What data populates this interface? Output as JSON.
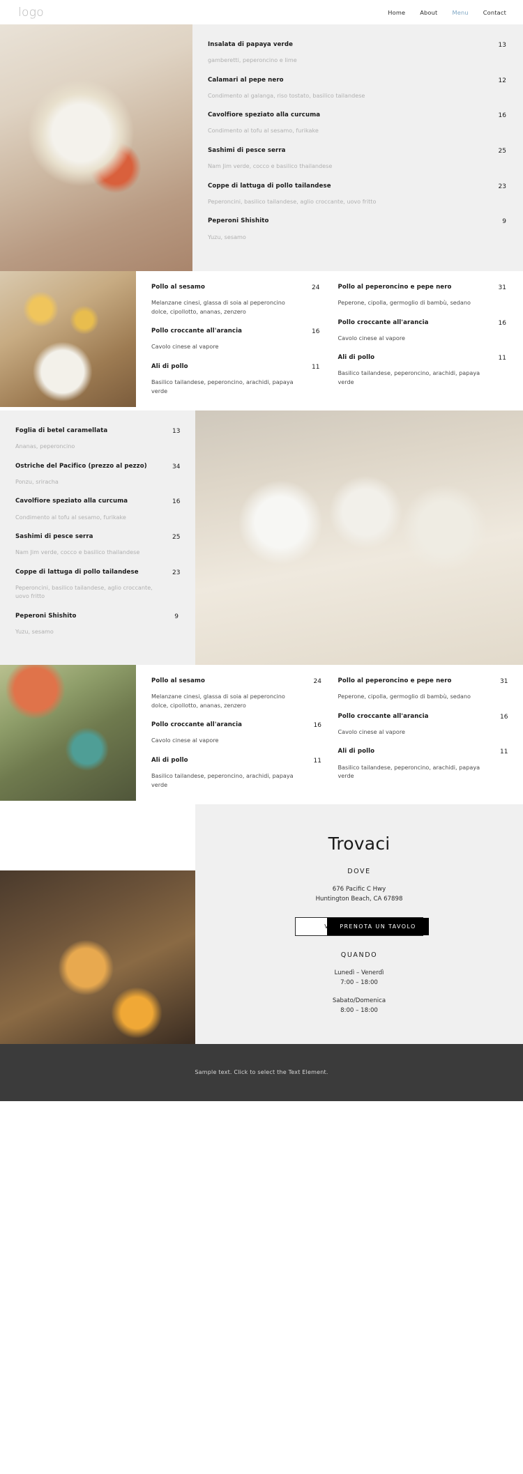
{
  "header": {
    "logo": "logo",
    "nav": [
      {
        "label": "Home",
        "active": false
      },
      {
        "label": "About",
        "active": false
      },
      {
        "label": "Menu",
        "active": true
      },
      {
        "label": "Contact",
        "active": false
      }
    ]
  },
  "sections": {
    "section1": {
      "photo_name": "dining-plate-photo",
      "items": [
        {
          "name": "Insalata di papaya verde",
          "price": "13",
          "desc": "gamberetti, peperoncino e lime"
        },
        {
          "name": "Calamari al pepe nero",
          "price": "12",
          "desc": "Condimento al galanga, riso tostato, basilico tailandese"
        },
        {
          "name": "Cavolfiore speziato alla curcuma",
          "price": "16",
          "desc": "Condimento al tofu al sesamo, furikake"
        },
        {
          "name": "Sashimi di pesce serra",
          "price": "25",
          "desc": "Nam Jim verde, cocco e basilico thailandese"
        },
        {
          "name": "Coppe di lattuga di pollo tailandese",
          "price": "23",
          "desc": "Peperoncini, basilico tailandese, aglio croccante, uovo fritto"
        },
        {
          "name": "Peperoni Shishito",
          "price": "9",
          "desc": "Yuzu, sesamo"
        }
      ]
    },
    "section2": {
      "photo_name": "beer-table-photo",
      "left_items": [
        {
          "name": "Pollo al sesamo",
          "price": "24",
          "desc": "Melanzane cinesi, glassa di soia al peperoncino dolce, cipollotto, ananas, zenzero"
        },
        {
          "name": "Pollo croccante all'arancia",
          "price": "16",
          "desc": "Cavolo cinese al vapore"
        },
        {
          "name": "Ali di pollo",
          "price": "11",
          "desc": "Basilico tailandese, peperoncino, arachidi, papaya verde"
        }
      ],
      "right_items": [
        {
          "name": "Pollo al peperoncino e pepe nero",
          "price": "31",
          "desc": "Peperone, cipolla, germoglio di bambù, sedano"
        },
        {
          "name": "Pollo croccante all'arancia",
          "price": "16",
          "desc": "Cavolo cinese al vapore"
        },
        {
          "name": "Ali di pollo",
          "price": "11",
          "desc": "Basilico tailandese, peperoncino, arachidi, papaya verde"
        }
      ]
    },
    "section3": {
      "photo_name": "wine-glasses-table-photo",
      "items": [
        {
          "name": "Foglia di betel caramellata",
          "price": "13",
          "desc": "Ananas, peperoncino"
        },
        {
          "name": "Ostriche del Pacifico (prezzo al pezzo)",
          "price": "34",
          "desc": "Ponzu, sriracha"
        },
        {
          "name": "Cavolfiore speziato alla curcuma",
          "price": "16",
          "desc": "Condimento al tofu al sesamo, furikake"
        },
        {
          "name": "Sashimi di pesce serra",
          "price": "25",
          "desc": "Nam Jim verde, cocco e basilico thailandese"
        },
        {
          "name": "Coppe di lattuga di pollo tailandese",
          "price": "23",
          "desc": "Peperoncini, basilico tailandese, aglio croccante, uovo fritto"
        },
        {
          "name": "Peperoni Shishito",
          "price": "9",
          "desc": "Yuzu, sesamo"
        }
      ]
    },
    "section4": {
      "photo_name": "patio-seating-photo",
      "left_items": [
        {
          "name": "Pollo al sesamo",
          "price": "24",
          "desc": "Melanzane cinesi, glassa di soia al peperoncino dolce, cipollotto, ananas, zenzero"
        },
        {
          "name": "Pollo croccante all'arancia",
          "price": "16",
          "desc": "Cavolo cinese al vapore"
        },
        {
          "name": "Ali di pollo",
          "price": "11",
          "desc": "Basilico tailandese, peperoncino, arachidi, papaya verde"
        }
      ],
      "right_items": [
        {
          "name": "Pollo al peperoncino e pepe nero",
          "price": "31",
          "desc": "Peperone, cipolla, germoglio di bambù, sedano"
        },
        {
          "name": "Pollo croccante all'arancia",
          "price": "16",
          "desc": "Cavolo cinese al vapore"
        },
        {
          "name": "Ali di pollo",
          "price": "11",
          "desc": "Basilico tailandese, peperoncino, arachidi, papaya verde"
        }
      ]
    }
  },
  "contact": {
    "photo_name": "server-with-food-photo",
    "title": "Trovaci",
    "where_label": "DOVE",
    "address_line1": "676 Pacific C Hwy",
    "address_line2": "Huntington Beach, CA 67898",
    "button_outline": "VISUALIZZA MAPPA",
    "button_filled": "PRENOTA UN TAVOLO",
    "when_label": "QUANDO",
    "hours_weekday_days": "Lunedì – Venerdì",
    "hours_weekday_time": "7:00 – 18:00",
    "hours_weekend_days": "Sabato/Domenica",
    "hours_weekend_time": "8:00 – 18:00"
  },
  "footer": {
    "text": "Sample text. Click to select the Text Element."
  },
  "colors": {
    "accent": "#7fa7c4",
    "panel_gray": "#f0f0f0",
    "footer_bg": "#3b3b3b",
    "muted_text": "#b0b0b0"
  }
}
